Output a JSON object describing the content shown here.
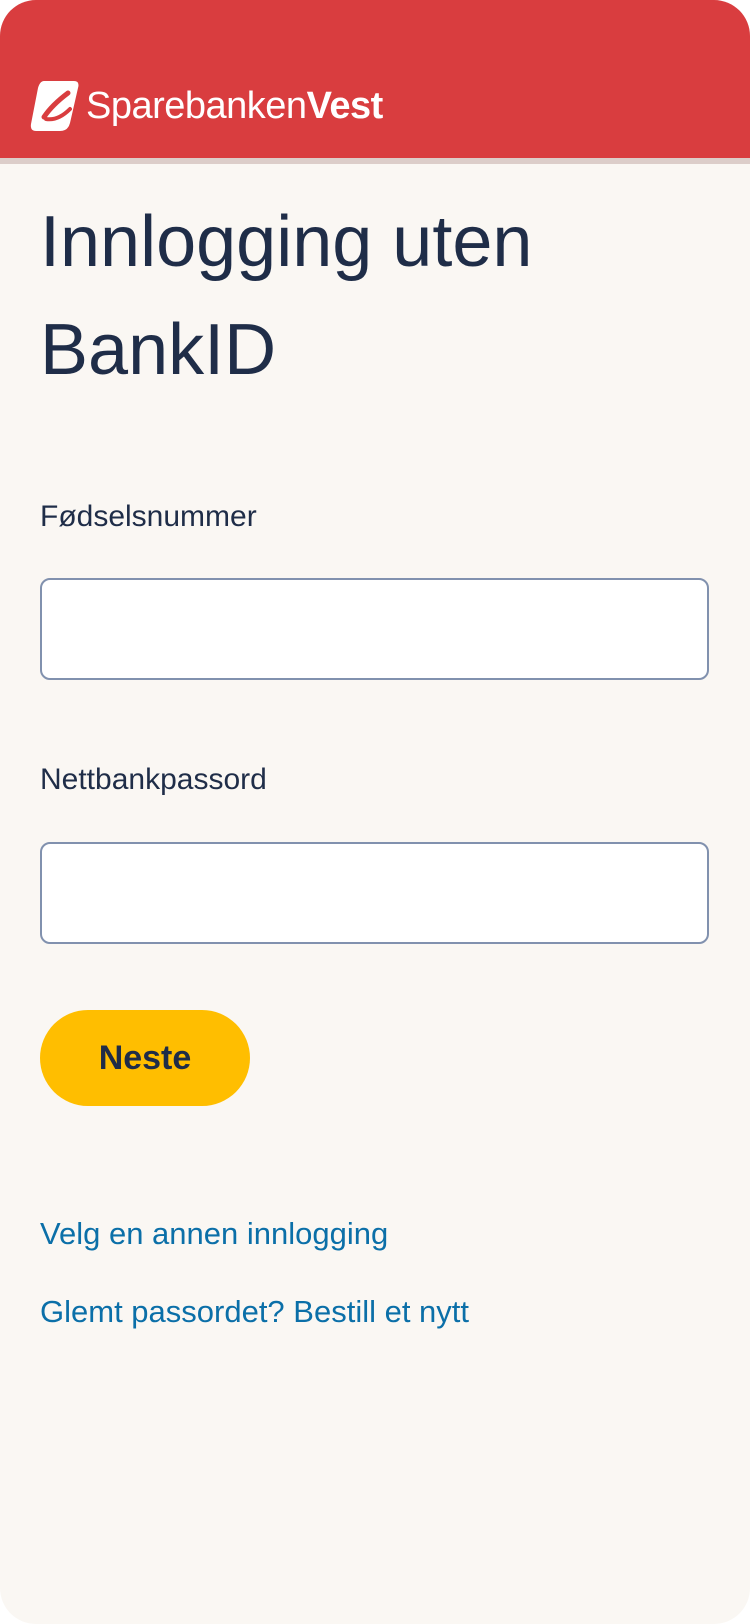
{
  "header": {
    "logo_text_light": "Sparebanken",
    "logo_text_bold": "Vest",
    "logo_icon": "sparebanken-vest-logo-icon",
    "background_color": "#d93d3f"
  },
  "main": {
    "title": "Innlogging uten BankID",
    "ssn_label": "Fødselsnummer",
    "ssn_value": "",
    "password_label": "Nettbankpassord",
    "password_value": "",
    "next_button_label": "Neste",
    "other_login_link": "Velg en annen innlogging",
    "forgot_password_link": "Glemt passordet? Bestill et nytt"
  },
  "colors": {
    "accent_button": "#ffbe00",
    "link": "#0b6fa8",
    "text": "#1f2d48",
    "page_background": "#faf7f3"
  }
}
